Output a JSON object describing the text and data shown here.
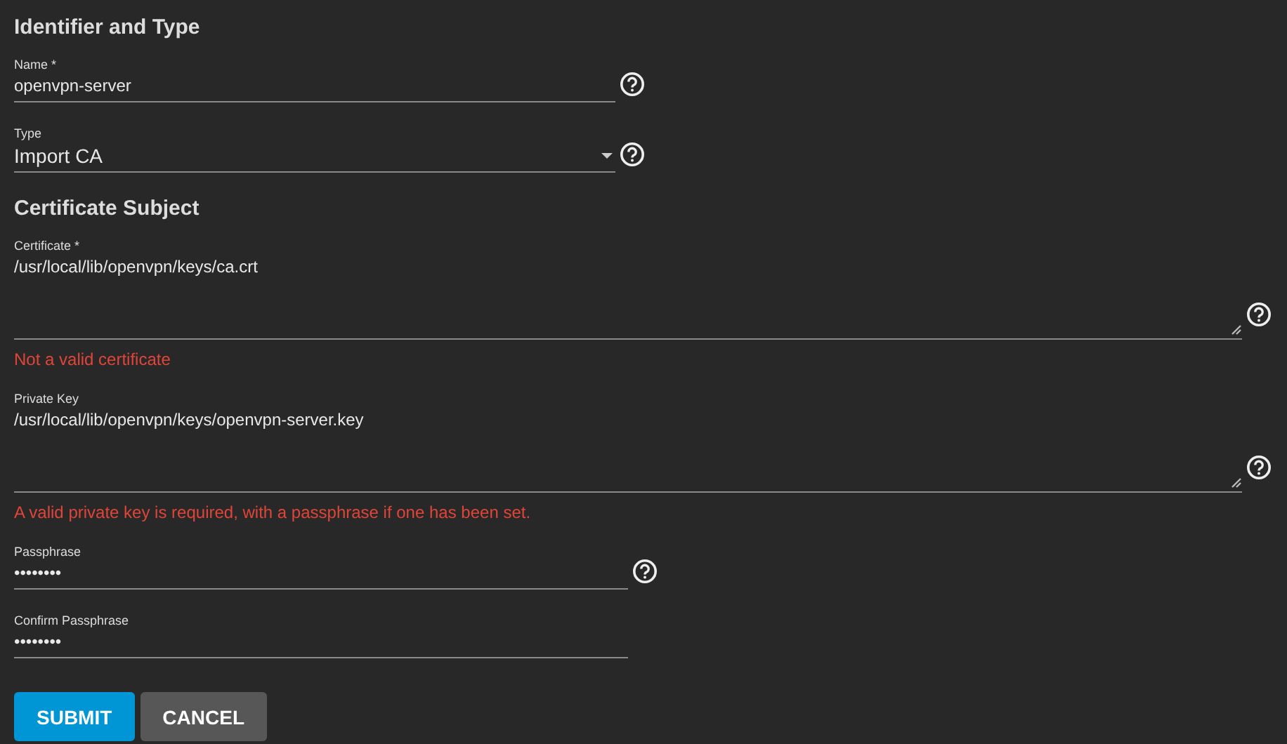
{
  "sections": [
    {
      "heading": "Identifier and Type",
      "fields": [
        {
          "kind": "text",
          "label": "Name *",
          "value": "openvpn-server",
          "help": true
        },
        {
          "kind": "select",
          "label": "Type",
          "value": "Import CA",
          "help": true
        }
      ]
    },
    {
      "heading": "Certificate Subject",
      "fields": [
        {
          "kind": "textarea",
          "label": "Certificate *",
          "value": "/usr/local/lib/openvpn/keys/ca.crt",
          "error": "Not a valid certificate",
          "help": true
        },
        {
          "kind": "textarea",
          "label": "Private Key",
          "value": "/usr/local/lib/openvpn/keys/openvpn-server.key",
          "error": "A valid private key is required, with a passphrase if one has been set.",
          "help": true
        },
        {
          "kind": "password",
          "label": "Passphrase",
          "value": "••••••••",
          "help": true
        },
        {
          "kind": "password",
          "label": "Confirm Passphrase",
          "value": "••••••••",
          "help": false
        }
      ]
    }
  ],
  "buttons": [
    {
      "kind": "primary",
      "label": "SUBMIT"
    },
    {
      "kind": "secondary",
      "label": "CANCEL"
    }
  ]
}
